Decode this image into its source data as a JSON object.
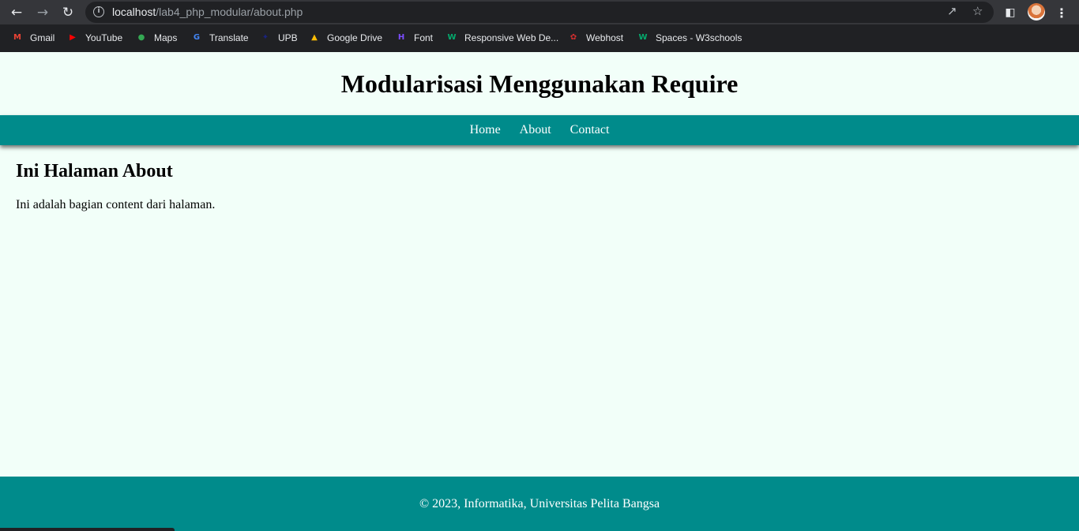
{
  "browser": {
    "url_host": "localhost",
    "url_path": "/lab4_php_modular/about.php",
    "bookmarks": [
      {
        "label": "Gmail",
        "icon": "gmail-icon",
        "color": "#ea4335",
        "glyph": "M"
      },
      {
        "label": "YouTube",
        "icon": "youtube-icon",
        "color": "#ff0000",
        "glyph": "▶"
      },
      {
        "label": "Maps",
        "icon": "maps-icon",
        "color": "#34a853",
        "glyph": "●"
      },
      {
        "label": "Translate",
        "icon": "translate-icon",
        "color": "#4285f4",
        "glyph": "G"
      },
      {
        "label": "UPB",
        "icon": "upb-icon",
        "color": "#1a237e",
        "glyph": "✦"
      },
      {
        "label": "Google Drive",
        "icon": "google-drive-icon",
        "color": "#fbbc04",
        "glyph": "▲"
      },
      {
        "label": "Font",
        "icon": "font-icon",
        "color": "#7c4dff",
        "glyph": "H"
      },
      {
        "label": "Responsive Web De...",
        "icon": "w3schools-icon",
        "color": "#04aa6d",
        "glyph": "W"
      },
      {
        "label": "Webhost",
        "icon": "webhost-icon",
        "color": "#d32f2f",
        "glyph": "✿"
      },
      {
        "label": "Spaces - W3schools",
        "icon": "w3schools-spaces-icon",
        "color": "#04aa6d",
        "glyph": "W"
      }
    ]
  },
  "page": {
    "title": "Modularisasi Menggunakan Require",
    "nav": [
      "Home",
      "About",
      "Contact"
    ],
    "heading": "Ini Halaman About",
    "paragraph": "Ini adalah bagian content dari halaman.",
    "footer": "© 2023, Informatika, Universitas Pelita Bangsa"
  },
  "colors": {
    "accent": "#008b8b",
    "background": "#f2fff9"
  }
}
